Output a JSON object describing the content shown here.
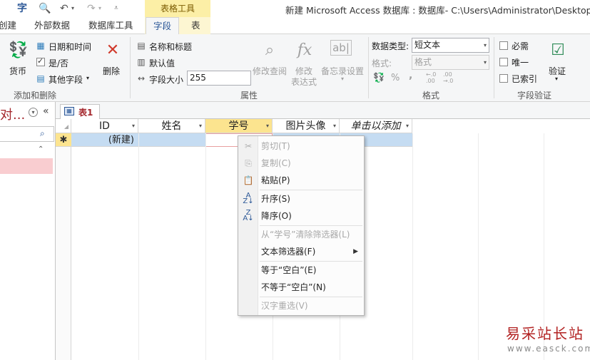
{
  "title_bar": {
    "contextual_tab_group": "表格工具",
    "window_title": "新建 Microsoft Access 数据库 : 数据库- C:\\Users\\Administrator\\Desktop\\新"
  },
  "tabs": [
    {
      "label": "创建"
    },
    {
      "label": "外部数据"
    },
    {
      "label": "数据库工具"
    },
    {
      "label": "字段"
    },
    {
      "label": "表"
    }
  ],
  "active_tab": "字段",
  "ribbon": {
    "add_delete": {
      "currency": "货币",
      "datetime": "日期和时间",
      "yesno": "是/否",
      "more_fields": "其他字段",
      "delete": "删除",
      "group_label": "添加和删除"
    },
    "properties": {
      "name_caption": "名称和标题",
      "default_value": "默认值",
      "field_size_label": "字段大小",
      "field_size_value": "255",
      "modify_lookups": "修改查阅",
      "modify_expression_1": "修改",
      "modify_expression_2": "表达式",
      "memo_settings": "备忘录设置",
      "group_label": "属性"
    },
    "formatting": {
      "data_type_label": "数据类型:",
      "data_type_value": "短文本",
      "format_label": "格式:",
      "format_value": "格式",
      "percent": "%",
      "comma": ",",
      "group_label": "格式"
    },
    "validation": {
      "required": "必需",
      "unique": "唯一",
      "indexed": "已索引",
      "validation": "验证",
      "group_label": "字段验证"
    }
  },
  "nav_pane": {
    "title": "对...",
    "toggle": "«"
  },
  "document_tab": {
    "label": "表1"
  },
  "datasheet": {
    "columns": [
      {
        "label": "ID"
      },
      {
        "label": "姓名"
      },
      {
        "label": "学号"
      },
      {
        "label": "图片头像"
      },
      {
        "label": "单击以添加"
      }
    ],
    "new_row_marker": "✱",
    "new_row_value": "(新建)"
  },
  "context_menu": {
    "items": [
      {
        "label": "剪切(T)",
        "enabled": false
      },
      {
        "label": "复制(C)",
        "enabled": false
      },
      {
        "label": "粘贴(P)",
        "enabled": true
      },
      {
        "label": "升序(S)",
        "enabled": true
      },
      {
        "label": "降序(O)",
        "enabled": true
      },
      {
        "label": "从“学号”清除筛选器(L)",
        "enabled": false
      },
      {
        "label": "文本筛选器(F)",
        "enabled": true
      },
      {
        "label": "等于“空白”(E)",
        "enabled": true
      },
      {
        "label": "不等于“空白”(N)",
        "enabled": true
      },
      {
        "label": "汉字重选(V)",
        "enabled": false
      }
    ]
  },
  "watermark": {
    "line1": "易采站长站",
    "line2": "www.easck.com"
  }
}
